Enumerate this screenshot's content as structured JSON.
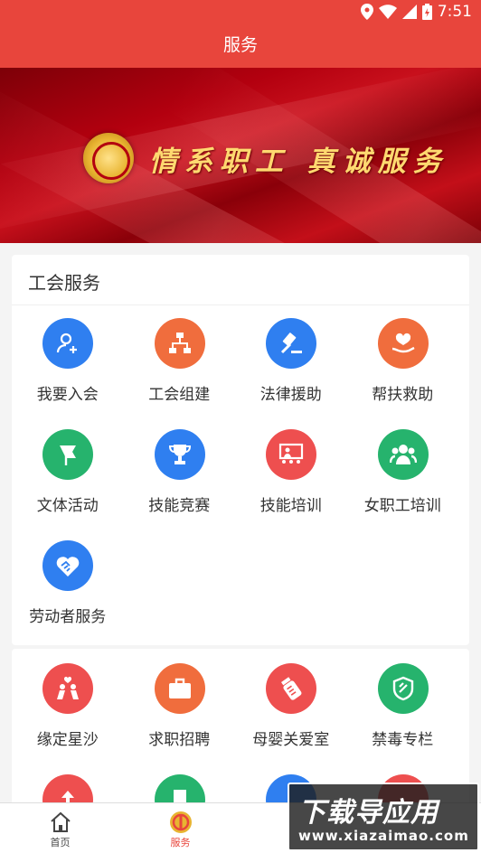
{
  "status_bar": {
    "time": "7:51"
  },
  "header": {
    "title": "服务"
  },
  "banner": {
    "slogan": "情系职工 真诚服务"
  },
  "section1": {
    "title": "工会服务",
    "items": [
      {
        "label": "我要入会",
        "icon": "user-add-icon",
        "color": "#2f7ff0"
      },
      {
        "label": "工会组建",
        "icon": "org-chart-icon",
        "color": "#f06d3d"
      },
      {
        "label": "法律援助",
        "icon": "gavel-icon",
        "color": "#2f7ff0"
      },
      {
        "label": "帮扶救助",
        "icon": "heart-hand-icon",
        "color": "#f06d3d"
      },
      {
        "label": "文体活动",
        "icon": "flag-icon",
        "color": "#26b36d"
      },
      {
        "label": "技能竞赛",
        "icon": "trophy-icon",
        "color": "#2f7ff0"
      },
      {
        "label": "技能培训",
        "icon": "training-board-icon",
        "color": "#ee4f4f"
      },
      {
        "label": "女职工培训",
        "icon": "women-group-icon",
        "color": "#26b36d"
      },
      {
        "label": "劳动者服务",
        "icon": "handshake-heart-icon",
        "color": "#2f7ff0"
      }
    ]
  },
  "section2": {
    "items": [
      {
        "label": "缘定星沙",
        "icon": "couple-icon",
        "color": "#ee4f4f"
      },
      {
        "label": "求职招聘",
        "icon": "briefcase-icon",
        "color": "#f06d3d"
      },
      {
        "label": "母婴关爱室",
        "icon": "baby-bottle-icon",
        "color": "#ee4f4f"
      },
      {
        "label": "禁毒专栏",
        "icon": "shield-icon",
        "color": "#26b36d"
      },
      {
        "label": "",
        "icon": "arrow-up-icon",
        "color": "#ee4f4f"
      },
      {
        "label": "",
        "icon": "document-icon",
        "color": "#26b36d"
      },
      {
        "label": "",
        "icon": "circle-icon",
        "color": "#2f7ff0"
      },
      {
        "label": "",
        "icon": "circle-icon",
        "color": "#ee4f4f"
      }
    ]
  },
  "bottom_nav": [
    {
      "label": "首页",
      "icon": "home-icon",
      "active": false
    },
    {
      "label": "服务",
      "icon": "union-emblem-icon",
      "active": true
    },
    {
      "label": "",
      "icon": "hidden-icon",
      "active": false
    },
    {
      "label": "",
      "icon": "hidden-icon",
      "active": false
    }
  ],
  "watermark": {
    "title": "下载导应用",
    "url": "www.xiazaimao.com"
  },
  "colors": {
    "primary": "#e8453c",
    "accent_gold": "#ffd970"
  }
}
